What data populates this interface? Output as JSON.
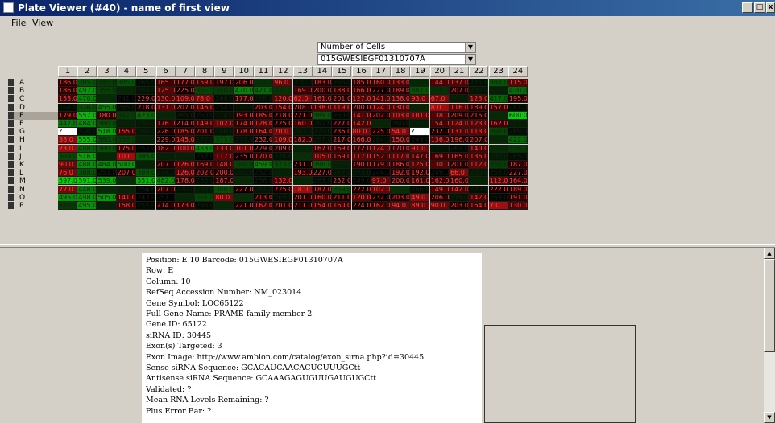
{
  "window": {
    "title": "Plate Viewer (#40) - name of first view",
    "minimize": "_",
    "maximize": "□",
    "close": "x"
  },
  "menu": {
    "file": "File",
    "view": "View"
  },
  "selectors": {
    "metric": "Number of Cells",
    "barcode": "015GWESIEGF01310707A"
  },
  "plate": {
    "columns": [
      "1",
      "2",
      "3",
      "4",
      "5",
      "6",
      "7",
      "8",
      "9",
      "10",
      "11",
      "12",
      "13",
      "14",
      "15",
      "16",
      "17",
      "18",
      "19",
      "20",
      "21",
      "22",
      "23",
      "24"
    ],
    "rows": [
      "A",
      "B",
      "C",
      "D",
      "E",
      "F",
      "G",
      "H",
      "I",
      "J",
      "K",
      "L",
      "M",
      "N",
      "O",
      "P"
    ],
    "selected_row": "E",
    "values": [
      [
        "186.0",
        "385.0",
        "345.0",
        "385.0",
        "265.0",
        "165.0",
        "177.0",
        "159.0",
        "197.0",
        "206.0",
        "327.0",
        "96.0",
        "270.0",
        "183.0",
        "266.0",
        "185.0",
        "160.0",
        "133.0",
        "311.0",
        "144.0",
        "137.0",
        "271.0",
        "388.0",
        "115.0"
      ],
      [
        "186.0",
        "497.0",
        "355.0",
        "311.0",
        "280.0",
        "125.0",
        "225.0",
        "365.0",
        "350.0",
        "470.0",
        "421.0",
        "335.0",
        "169.0",
        "200.0",
        "188.0",
        "166.0",
        "227.0",
        "189.0",
        "387.0",
        "330.0",
        "207.0",
        "285.0",
        "300.0",
        "430.0"
      ],
      [
        "153.0",
        "470.0",
        "320.0",
        "241.0",
        "229.0",
        "130.0",
        "109.0",
        "78.0",
        "266.0",
        "177.0",
        "268.0",
        "120.0",
        "62.0",
        "161.0",
        "201.0",
        "127.0",
        "141.0",
        "138.0",
        "93.0",
        "67.0",
        "291.0",
        "123.0",
        "417.0",
        "195.0"
      ],
      [
        "267.0",
        "376.0",
        "455.0",
        "265.0",
        "218.0",
        "131.0",
        "207.0",
        "146.0",
        "254.0",
        "270.0",
        "203.0",
        "154.0",
        "208.0",
        "138.0",
        "119.0",
        "200.0",
        "124.0",
        "130.0",
        "306.0",
        "8.0",
        "116.0",
        "189.0",
        "157.0",
        "261.0"
      ],
      [
        "179.0",
        "557.0",
        "180.0",
        "347.0",
        "423.0",
        "313.0",
        "265.0",
        "260.0",
        "274.0",
        "193.0",
        "185.0",
        "218.0",
        "221.0",
        "389.0",
        "260.0",
        "141.0",
        "202.0",
        "103.0",
        "101.0",
        "138.0",
        "209.0",
        "215.0",
        "318.0",
        "600.0"
      ],
      [
        "447.0",
        "484.0",
        "380.0",
        "300.0",
        "286.0",
        "176.0",
        "214.0",
        "149.0",
        "102.0",
        "174.0",
        "128.0",
        "225.0",
        "160.0",
        "262.0",
        "227.0",
        "142.0",
        "310.0",
        "260.0",
        "293.0",
        "154.0",
        "124.0",
        "123.0",
        "162.0",
        "292.0"
      ],
      [
        "?",
        "270.0",
        "518.0",
        "155.0",
        "288.0",
        "226.0",
        "185.0",
        "201.0",
        "280.0",
        "178.0",
        "164.0",
        "70.0",
        "283.0",
        "273.0",
        "236.0",
        "80.0",
        "225.0",
        "54.0",
        "?",
        "232.0",
        "131.0",
        "113.0",
        "360.0",
        "269.0"
      ],
      [
        "38.0",
        "555.0",
        "380.0",
        "356.0",
        "302.0",
        "229.0",
        "145.0",
        "277.0",
        "373.0",
        "272.0",
        "232.0",
        "109.0",
        "182.0",
        "267.0",
        "217.0",
        "166.0",
        "264.0",
        "150.0",
        "249.0",
        "136.0",
        "196.0",
        "207.0",
        "311.0",
        "422.0"
      ],
      [
        "23.0",
        "408.0",
        "380.0",
        "175.0",
        "251.0",
        "182.0",
        "100.0",
        "453.0",
        "133.0",
        "101.0",
        "229.0",
        "209.0",
        "305.0",
        "167.0",
        "169.0",
        "172.0",
        "124.0",
        "170.0",
        "91.0",
        "277.0",
        "262.0",
        "140.0",
        "318.0",
        "338.0"
      ],
      [
        "369.0",
        "516.0",
        "311.0",
        "10.0",
        "395.0",
        "300.0",
        "302.0",
        "252.0",
        "117.0",
        "235.0",
        "170.0",
        "276.0",
        "328.0",
        "105.0",
        "169.0",
        "117.0",
        "152.0",
        "117.0",
        "147.0",
        "169.0",
        "165.0",
        "136.0",
        "290.0",
        "265.0"
      ],
      [
        "90.0",
        "488.0",
        "484.0",
        "500.0",
        "302.0",
        "207.0",
        "126.0",
        "169.0",
        "148.0",
        "360.0",
        "459.0",
        "373.0",
        "231.0",
        "396.0",
        "299.0",
        "190.0",
        "179.0",
        "186.0",
        "125.0",
        "130.0",
        "201.0",
        "112.0",
        "350.0",
        "187.0"
      ],
      [
        "76.0",
        "388.0",
        "253.0",
        "207.0",
        "389.0",
        "274.0",
        "126.0",
        "202.0",
        "200.0",
        "280.0",
        "252.0",
        "301.0",
        "193.0",
        "227.0",
        "277.0",
        "273.0",
        "246.0",
        "192.0",
        "192.0",
        "249.0",
        "66.0",
        "286.0",
        "258.0",
        "227.0"
      ],
      [
        "597.0",
        "591.0",
        "539.0",
        "328.0",
        "551.0",
        "482.0",
        "178.0",
        "263.0",
        "187.0",
        "318.0",
        "256.0",
        "132.0",
        "311.0",
        "263.0",
        "232.0",
        "249.0",
        "97.0",
        "200.0",
        "161.0",
        "162.0",
        "160.0",
        "297.0",
        "112.0",
        "164.0"
      ],
      [
        "72.0",
        "448.0",
        "318.0",
        "307.0",
        "254.0",
        "207.0",
        "270.0",
        "289.0",
        "380.0",
        "227.0",
        "281.0",
        "225.0",
        "18.0",
        "187.0",
        "369.0",
        "222.0",
        "102.0",
        "329.0",
        "266.0",
        "149.0",
        "142.0",
        "270.0",
        "222.0",
        "189.0"
      ],
      [
        "495.0",
        "498.0",
        "505.0",
        "141.0",
        "243.0",
        "251.0",
        "309.0",
        "361.0",
        "80.0",
        "326.0",
        "213.0",
        "269.0",
        "201.0",
        "160.0",
        "211.0",
        "120.0",
        "232.0",
        "203.0",
        "49.0",
        "206.0",
        "279.0",
        "142.0",
        "259.0",
        "191.0"
      ],
      [
        "346.0",
        "495.0",
        "300.0",
        "158.0",
        "257.0",
        "214.0",
        "173.0",
        "263.0",
        "311.0",
        "221.0",
        "162.0",
        "201.0",
        "211.0",
        "154.0",
        "160.0",
        "224.0",
        "162.0",
        "94.0",
        "89.0",
        "90.0",
        "203.0",
        "164.0",
        "7.0",
        "130.0"
      ]
    ],
    "colors": {
      "low": "#a01010",
      "mid": "#000000",
      "high": "#00d400",
      "missing": "#ffffff",
      "selected_row_header": "#a9a39a"
    },
    "scale_max": 600
  },
  "info": [
    "Position: E 10 Barcode: 015GWESIEGF01310707A",
    "Row: E",
    "Column: 10",
    "RefSeq Accession Number: NM_023014",
    "Gene Symbol: LOC65122",
    "Full Gene Name: PRAME family member 2",
    "Gene ID: 65122",
    "siRNA ID: 30445",
    "Exon(s) Targeted: 3",
    "Exon Image: http://www.ambion.com/catalog/exon_sirna.php?id=30445",
    "Sense siRNA Sequence: GCACAUCAACACUCUUUGCtt",
    "Antisense siRNA Sequence: GCAAAGAGUGUUGAUGUGCtt",
    "Validated: ?",
    "Mean RNA Levels Remaining: ?",
    "Plus Error Bar: ?"
  ]
}
